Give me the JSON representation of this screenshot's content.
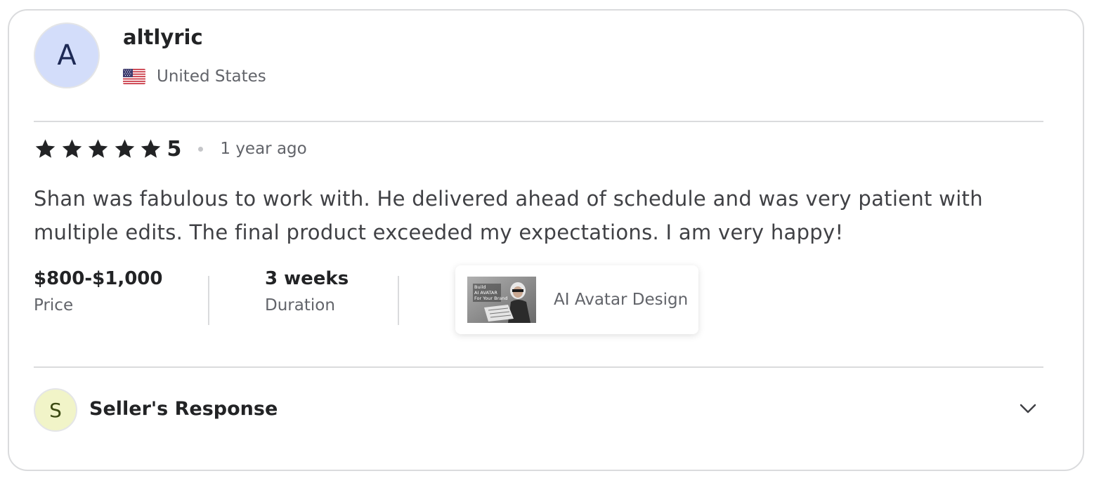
{
  "reviewer": {
    "avatar_initial": "A",
    "username": "altlyric",
    "country": "United States",
    "flag_icon": "us-flag-icon"
  },
  "rating": {
    "stars": 5,
    "value": "5",
    "star_color": "#222325",
    "time_ago": "1 year ago"
  },
  "review": {
    "text": "Shan was fabulous to work with. He delivered ahead of schedule and was very patient with multiple edits. The final product exceeded my expectations. I am very happy!"
  },
  "meta": {
    "price_value": "$800-$1,000",
    "price_label": "Price",
    "duration_value": "3 weeks",
    "duration_label": "Duration"
  },
  "gig": {
    "title": "AI Avatar Design",
    "thumb_caption": "Build AI AVATAR For Your Brand"
  },
  "seller_response": {
    "avatar_initial": "S",
    "label": "Seller's Response",
    "expand_icon": "chevron-down-icon"
  },
  "colors": {
    "avatar_bg": "#d3ddfa",
    "seller_avatar_bg": "#f1f4c8",
    "divider": "#dadbdd",
    "muted_text": "#62646a"
  }
}
